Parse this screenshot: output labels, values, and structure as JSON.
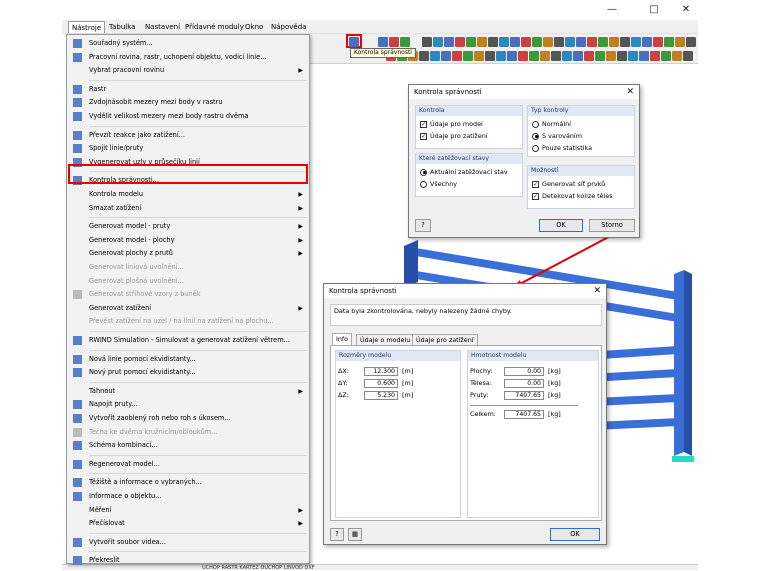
{
  "menubar": {
    "items": [
      "Nástroje",
      "Tabulka",
      "Nastavení",
      "Přídavné moduly",
      "Okno",
      "Nápověda"
    ]
  },
  "tooltip": "Kontrola správnosti",
  "status_text": "UCHOP  RASTR  KARTEZ  OUCHOP  LINVOD  DXF",
  "dropdown": {
    "items": [
      {
        "label": "Souřadný systém...",
        "arrow": false,
        "disabled": false,
        "icon": "coordinate-system-icon"
      },
      {
        "label": "Pracovní rovina, rastr, uchopení objektu, vodicí linie...",
        "arrow": false,
        "disabled": false,
        "icon": "work-plane-icon"
      },
      {
        "label": "Vybrat pracovní rovinu",
        "arrow": true,
        "disabled": false,
        "icon": ""
      },
      {
        "sep": true
      },
      {
        "label": "Rastr",
        "arrow": false,
        "disabled": false,
        "icon": "grid-icon"
      },
      {
        "label": "Zvdojnásobit mezery mezi body v rastru",
        "arrow": false,
        "disabled": false,
        "icon": "grid-double-icon"
      },
      {
        "label": "Vydělit velikost mezery mezi body rastru dvěma",
        "arrow": false,
        "disabled": false,
        "icon": "grid-divide-icon"
      },
      {
        "sep": true
      },
      {
        "label": "Převzít reakce jako zatížení...",
        "arrow": false,
        "disabled": false,
        "icon": "reactions-icon"
      },
      {
        "label": "Spojit linie/pruty",
        "arrow": false,
        "disabled": false,
        "icon": "connect-lines-icon"
      },
      {
        "label": "Vygenerovat uzly v průsečíku linií",
        "arrow": false,
        "disabled": false,
        "icon": "intersection-icon"
      },
      {
        "sep": true
      },
      {
        "label": "Kontrola správnosti...",
        "arrow": false,
        "disabled": false,
        "icon": "plausibility-check-icon"
      },
      {
        "label": "Kontrola modelu",
        "arrow": true,
        "disabled": false,
        "icon": ""
      },
      {
        "label": "Smazat zatížení",
        "arrow": true,
        "disabled": false,
        "icon": ""
      },
      {
        "sep": true
      },
      {
        "label": "Generovat model - pruty",
        "arrow": true,
        "disabled": false,
        "icon": ""
      },
      {
        "label": "Generovat model - plochy",
        "arrow": true,
        "disabled": false,
        "icon": ""
      },
      {
        "label": "Generovat plochy z prutů",
        "arrow": true,
        "disabled": false,
        "icon": ""
      },
      {
        "label": "Generovat liniová uvolnění...",
        "arrow": false,
        "disabled": true,
        "icon": ""
      },
      {
        "label": "Generovat plošná uvolnění...",
        "arrow": false,
        "disabled": true,
        "icon": ""
      },
      {
        "label": "Generovat stříhové vzory z buněk",
        "arrow": false,
        "disabled": true,
        "icon": "cutting-pattern-icon"
      },
      {
        "label": "Generovat zatížení",
        "arrow": true,
        "disabled": false,
        "icon": ""
      },
      {
        "label": "Převést zatížení na uzel / na linii na zatížení na plochu...",
        "arrow": false,
        "disabled": true,
        "icon": ""
      },
      {
        "sep": true
      },
      {
        "label": "RWIND Simulation - Simulovat a generovat zatížení větrem...",
        "arrow": false,
        "disabled": false,
        "icon": "rwind-icon"
      },
      {
        "sep": true
      },
      {
        "label": "Nová linie pomocí ekvidistanty...",
        "arrow": false,
        "disabled": false,
        "icon": "new-line-equidistant-icon"
      },
      {
        "label": "Nový prut pomocí ekvidistanty...",
        "arrow": false,
        "disabled": false,
        "icon": "new-member-equidistant-icon"
      },
      {
        "sep": true
      },
      {
        "label": "Táhnout",
        "arrow": true,
        "disabled": false,
        "icon": ""
      },
      {
        "label": "Napojit pruty...",
        "arrow": false,
        "disabled": false,
        "icon": "connect-members-icon"
      },
      {
        "label": "Vytvořit zaoblený roh nebo roh s úkosem...",
        "arrow": false,
        "disabled": false,
        "icon": "rounded-corner-icon"
      },
      {
        "label": "Tečna ke dvěma kružnicím/obloukům...",
        "arrow": false,
        "disabled": true,
        "icon": "tangent-icon"
      },
      {
        "label": "Schéma kombinací...",
        "arrow": false,
        "disabled": false,
        "icon": "combination-scheme-icon"
      },
      {
        "sep": true
      },
      {
        "label": "Regenerovat model...",
        "arrow": false,
        "disabled": false,
        "icon": "regenerate-model-icon"
      },
      {
        "sep": true
      },
      {
        "label": "Těžiště a informace o vybraných...",
        "arrow": false,
        "disabled": false,
        "icon": "centroid-icon"
      },
      {
        "label": "Informace o objektu...",
        "arrow": false,
        "disabled": false,
        "icon": "object-info-icon"
      },
      {
        "label": "Měření",
        "arrow": true,
        "disabled": false,
        "icon": ""
      },
      {
        "label": "Přečíslovat",
        "arrow": true,
        "disabled": false,
        "icon": ""
      },
      {
        "sep": true
      },
      {
        "label": "Vytvořit soubor videa...",
        "arrow": false,
        "disabled": false,
        "icon": "video-icon"
      },
      {
        "sep": true
      },
      {
        "label": "Překreslit",
        "arrow": false,
        "disabled": false,
        "icon": "redraw-icon"
      }
    ]
  },
  "dialog1": {
    "title": "Kontrola správnosti",
    "group_check": {
      "header": "Kontrola",
      "options": [
        {
          "label": "Údaje pro model",
          "checked": true
        },
        {
          "label": "Údaje pro zatížení",
          "checked": true
        }
      ]
    },
    "group_type": {
      "header": "Typ kontroly",
      "options": [
        {
          "label": "Normální",
          "selected": false
        },
        {
          "label": "S varováním",
          "selected": true
        },
        {
          "label": "Pouze statistika",
          "selected": false
        }
      ]
    },
    "group_states": {
      "header": "Které zatěžovací stavy",
      "options": [
        {
          "label": "Aktuální zatěžovací stav",
          "selected": true
        },
        {
          "label": "Všechny",
          "selected": false
        }
      ]
    },
    "group_options": {
      "header": "Možnosti",
      "options": [
        {
          "label": "Generovat síť prvků",
          "checked": true
        },
        {
          "label": "Detekovat kolize těles",
          "checked": true
        }
      ]
    },
    "ok": "OK",
    "cancel": "Storno"
  },
  "dialog2": {
    "title": "Kontrola správnosti",
    "message": "Data byla zkontrolována, nebyly nalezeny žádné chyby.",
    "tabs": [
      "Info",
      "Údaje o modelu",
      "Údaje pro zatížení"
    ],
    "dims": {
      "header": "Rozměry modelu",
      "rows": [
        {
          "label": "ΔX:",
          "value": "12.300",
          "unit": "[m]"
        },
        {
          "label": "ΔY:",
          "value": "0.600",
          "unit": "[m]"
        },
        {
          "label": "ΔZ:",
          "value": "5.230",
          "unit": "[m]"
        }
      ]
    },
    "mass": {
      "header": "Hmotnost modelu",
      "rows": [
        {
          "label": "Plochy:",
          "value": "0.00",
          "unit": "[kg]"
        },
        {
          "label": "Tělesa:",
          "value": "0.00",
          "unit": "[kg]"
        },
        {
          "label": "Pruty:",
          "value": "7407.65",
          "unit": "[kg]"
        }
      ],
      "total": {
        "label": "Celkem:",
        "value": "7407.65",
        "unit": "[kg]"
      }
    },
    "ok": "OK"
  },
  "colors": {
    "member": "#3b6fd8",
    "member_dark": "#274fa8",
    "red": "#e00000",
    "support": "#26d9c8"
  }
}
